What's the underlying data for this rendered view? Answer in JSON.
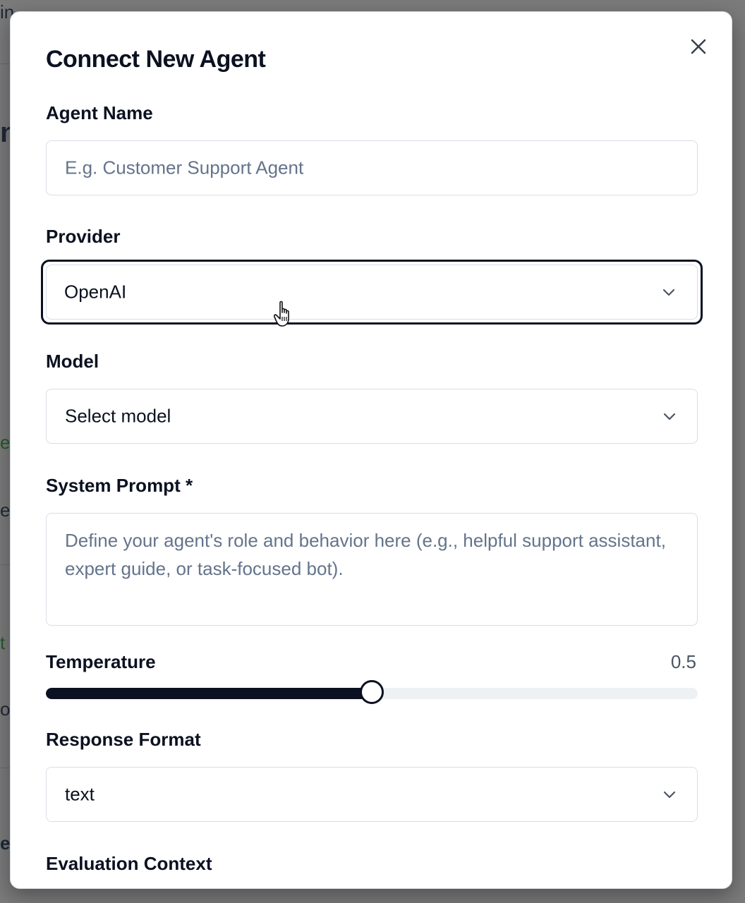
{
  "backdrop": {
    "fragments": [
      "in",
      "n",
      "e",
      "e",
      "t",
      "o",
      "e"
    ]
  },
  "dialog": {
    "title": "Connect New Agent",
    "close_icon": "close-icon"
  },
  "agent_name": {
    "label": "Agent Name",
    "placeholder": "E.g. Customer Support Agent",
    "value": ""
  },
  "provider": {
    "label": "Provider",
    "selected": "OpenAI"
  },
  "model": {
    "label": "Model",
    "selected": "Select model"
  },
  "system_prompt": {
    "label": "System Prompt *",
    "placeholder": "Define your agent's role and behavior here (e.g., helpful support assistant, expert guide, or task-focused bot).",
    "value": ""
  },
  "temperature": {
    "label": "Temperature",
    "value": "0.5",
    "fraction": 0.5
  },
  "response_format": {
    "label": "Response Format",
    "selected": "text"
  },
  "evaluation_context": {
    "label": "Evaluation Context"
  },
  "colors": {
    "text_primary": "#0b1120",
    "placeholder": "#64748b",
    "border": "#d9dee5",
    "slider_fill": "#0b1120",
    "slider_track": "#eef1f4"
  }
}
